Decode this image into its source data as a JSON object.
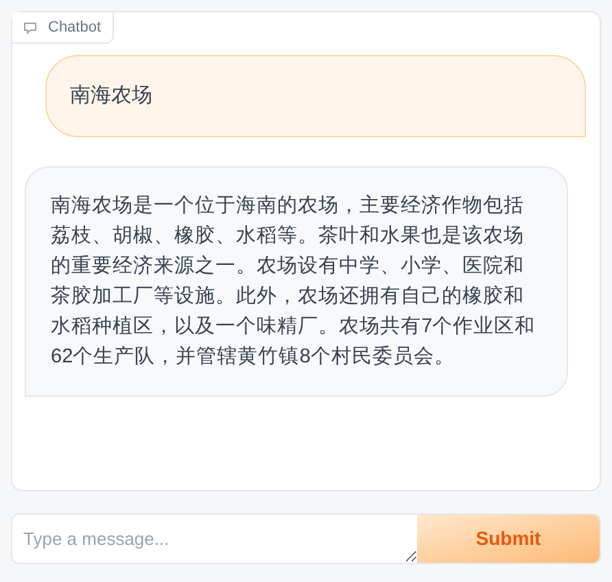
{
  "chatbot": {
    "label": "Chatbot",
    "messages": [
      {
        "kind": "user",
        "text": "南海农场"
      },
      {
        "kind": "bot",
        "text": "南海农场是一个位于海南的农场，主要经济作物包括荔枝、胡椒、橡胶、水稻等。茶叶和水果也是该农场的重要经济来源之一。农场设有中学、小学、医院和茶胶加工厂等设施。此外，农场还拥有自己的橡胶和水稻种植区，以及一个味精厂。农场共有7个作业区和62个生产队，并管辖黄竹镇8个村民委员会。"
      }
    ]
  },
  "input": {
    "placeholder": "Type a message..."
  },
  "submit": {
    "label": "Submit"
  }
}
